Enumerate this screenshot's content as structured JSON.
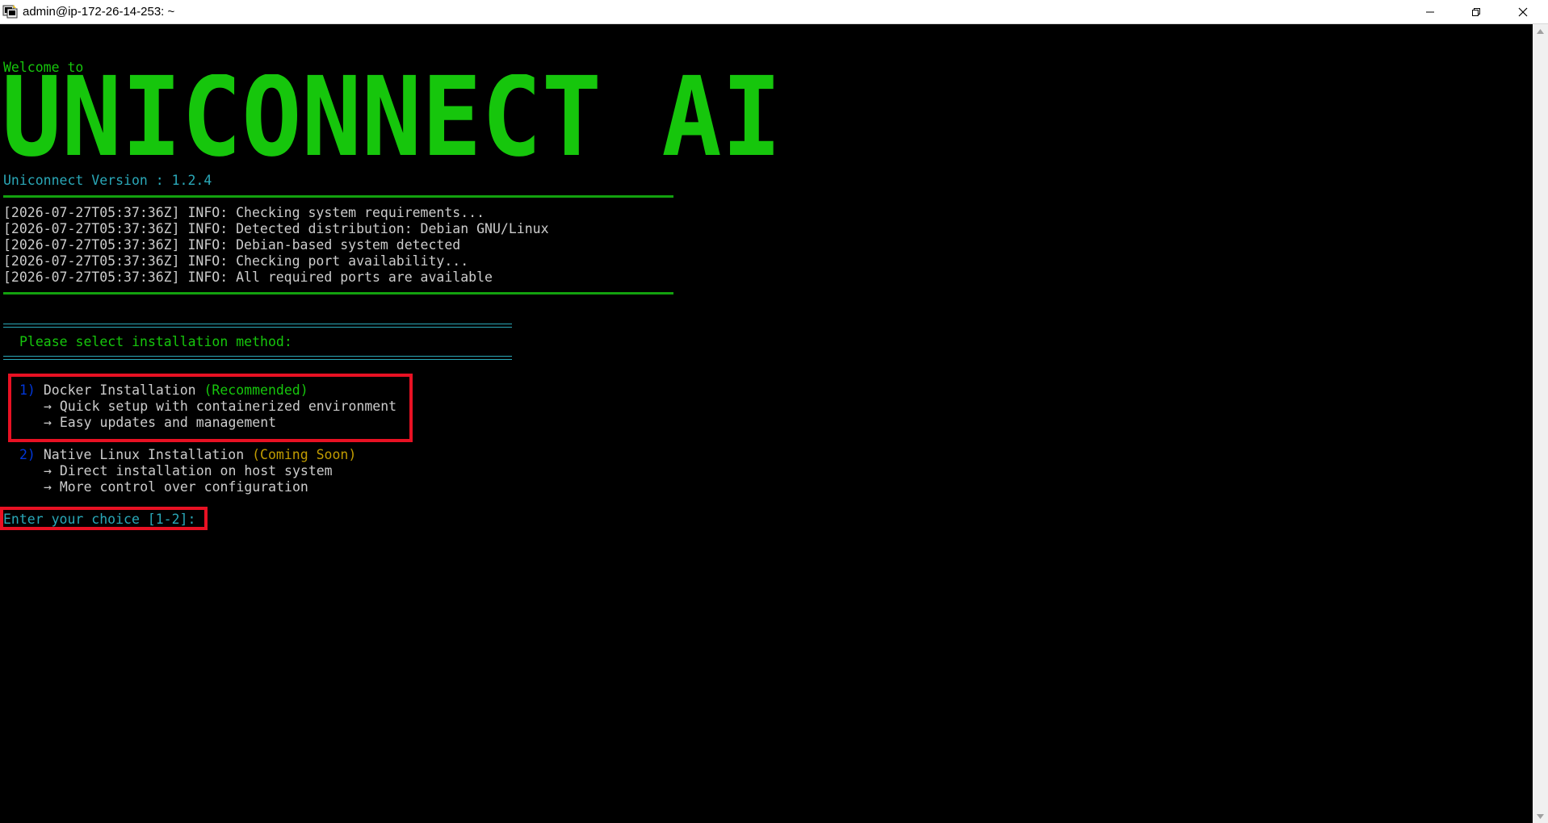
{
  "window": {
    "title": "admin@ip-172-26-14-253: ~"
  },
  "banner": {
    "welcome": "Welcome to",
    "title": "UNICONNECT AI",
    "version": "Uniconnect Version : 1.2.4"
  },
  "logs": [
    "[2026-07-27T05:37:36Z] INFO: Checking system requirements...",
    "[2026-07-27T05:37:36Z] INFO: Detected distribution: Debian GNU/Linux",
    "[2026-07-27T05:37:36Z] INFO: Debian-based system detected",
    "[2026-07-27T05:37:36Z] INFO: Checking port availability...",
    "[2026-07-27T05:37:36Z] INFO: All required ports are available"
  ],
  "menu": {
    "prompt": "Please select installation method:",
    "options": [
      {
        "number": "1)",
        "label": "Docker Installation",
        "tag": "(Recommended)",
        "details": [
          "→ Quick setup with containerized environment",
          "→ Easy updates and management"
        ]
      },
      {
        "number": "2)",
        "label": "Native Linux Installation",
        "tag": "(Coming Soon)",
        "details": [
          "→ Direct installation on host system",
          "→ More control over configuration"
        ]
      }
    ],
    "choice_prompt": "Enter your choice [1-2]:"
  },
  "colors": {
    "accent_green": "#16c60c",
    "accent_cyan": "#2aa8b8",
    "highlight_red": "#e81123",
    "tag_green": "#13a10e",
    "tag_yellow": "#c19c00",
    "option_number_blue": "#0037da"
  }
}
